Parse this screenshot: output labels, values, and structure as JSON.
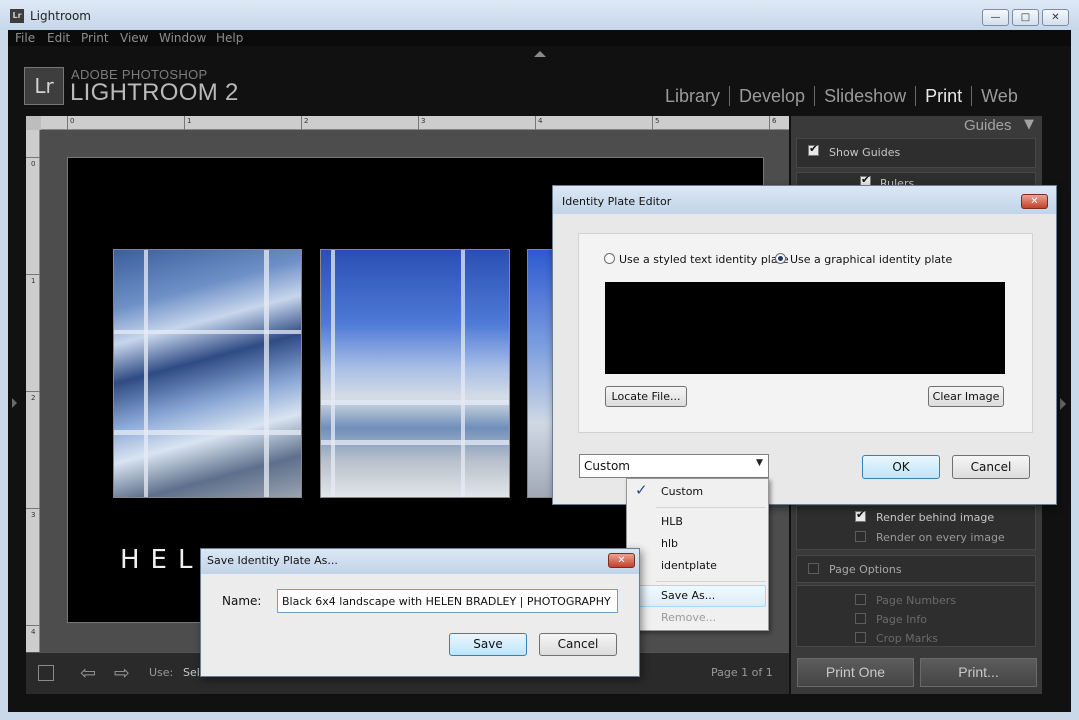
{
  "window": {
    "title": "Lightroom",
    "app_icon": "Lr",
    "min_glyph": "—",
    "max_glyph": "□",
    "close_glyph": "✕"
  },
  "menu": [
    "File",
    "Edit",
    "Print",
    "View",
    "Window",
    "Help"
  ],
  "identity": {
    "logo": "Lr",
    "line1": "ADOBE PHOTOSHOP",
    "line2": "LIGHTROOM 2"
  },
  "modules": [
    "Library",
    "Develop",
    "Slideshow",
    "Print",
    "Web"
  ],
  "active_module": "Print",
  "ruler": {
    "h_ticks": [
      "0",
      "1",
      "2",
      "3",
      "4",
      "5",
      "6"
    ],
    "v_ticks": [
      "0",
      "1",
      "2",
      "3",
      "4"
    ]
  },
  "page": {
    "caption_text": "HELE"
  },
  "toolbar": {
    "prev_icon": "⇦",
    "next_icon": "⇨",
    "use_label": "Use:",
    "use_value": "Sel",
    "page_indicator": "Page 1 of 1"
  },
  "right_panel": {
    "guides_header": "Guides",
    "guides_toggle": "▼",
    "show_guides": "Show Guides",
    "rulers": "Rulers",
    "render_behind": "Render behind image",
    "render_every": "Render on every image",
    "page_options": "Page Options",
    "page_numbers": "Page Numbers",
    "page_info": "Page Info",
    "crop_marks": "Crop Marks",
    "print_one": "Print One",
    "print": "Print..."
  },
  "ipe_dialog": {
    "title": "Identity Plate Editor",
    "close_glyph": "✕",
    "option_text": "Use a styled text identity plate",
    "option_graphic": "Use a graphical identity plate",
    "locate_file": "Locate File...",
    "clear_image": "Clear Image",
    "preset_value": "Custom",
    "dropdown_glyph": "▼",
    "ok": "OK",
    "cancel": "Cancel"
  },
  "preset_menu": {
    "check_glyph": "✓",
    "items": [
      "Custom",
      "HLB",
      "hlb",
      "identplate",
      "Save As...",
      "Remove..."
    ]
  },
  "save_dialog": {
    "title": "Save Identity Plate As...",
    "close_glyph": "✕",
    "name_label": "Name:",
    "name_value": "Black 6x4 landscape with HELEN BRADLEY | PHOTOGRAPHY",
    "save": "Save",
    "cancel": "Cancel"
  }
}
